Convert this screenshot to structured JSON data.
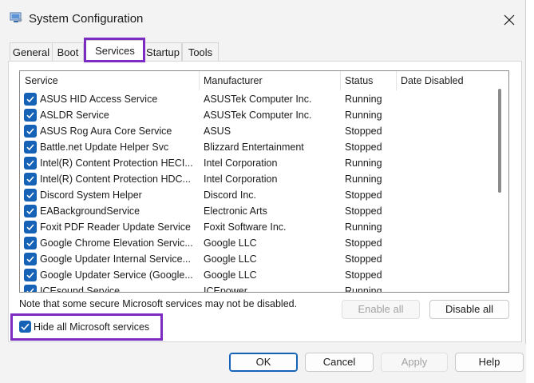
{
  "window": {
    "title": "System Configuration"
  },
  "tabs": [
    {
      "label": "General"
    },
    {
      "label": "Boot"
    },
    {
      "label": "Services"
    },
    {
      "label": "Startup"
    },
    {
      "label": "Tools"
    }
  ],
  "active_tab": "Services",
  "table": {
    "columns": [
      "Service",
      "Manufacturer",
      "Status",
      "Date Disabled"
    ],
    "rows": [
      {
        "service": "ASUS HID Access Service",
        "manufacturer": "ASUSTek Computer Inc.",
        "status": "Running",
        "checked": true
      },
      {
        "service": "ASLDR Service",
        "manufacturer": "ASUSTek Computer Inc.",
        "status": "Running",
        "checked": true
      },
      {
        "service": "ASUS Rog Aura Core Service",
        "manufacturer": "ASUS",
        "status": "Stopped",
        "checked": true
      },
      {
        "service": "Battle.net Update Helper Svc",
        "manufacturer": "Blizzard Entertainment",
        "status": "Stopped",
        "checked": true
      },
      {
        "service": "Intel(R) Content Protection HECI...",
        "manufacturer": "Intel Corporation",
        "status": "Running",
        "checked": true
      },
      {
        "service": "Intel(R) Content Protection HDC...",
        "manufacturer": "Intel Corporation",
        "status": "Running",
        "checked": true
      },
      {
        "service": "Discord System Helper",
        "manufacturer": "Discord Inc.",
        "status": "Stopped",
        "checked": true
      },
      {
        "service": "EABackgroundService",
        "manufacturer": "Electronic Arts",
        "status": "Stopped",
        "checked": true
      },
      {
        "service": "Foxit PDF Reader Update Service",
        "manufacturer": "Foxit Software Inc.",
        "status": "Running",
        "checked": true
      },
      {
        "service": "Google Chrome Elevation Servic...",
        "manufacturer": "Google LLC",
        "status": "Stopped",
        "checked": true
      },
      {
        "service": "Google Updater Internal Service...",
        "manufacturer": "Google LLC",
        "status": "Stopped",
        "checked": true
      },
      {
        "service": "Google Updater Service (Google...",
        "manufacturer": "Google LLC",
        "status": "Stopped",
        "checked": true
      },
      {
        "service": "ICEsound Service",
        "manufacturer": "ICEpower",
        "status": "Running",
        "checked": true
      }
    ]
  },
  "note": "Note that some secure Microsoft services may not be disabled.",
  "buttons": {
    "enable_all": "Enable all",
    "disable_all": "Disable all",
    "ok": "OK",
    "cancel": "Cancel",
    "apply": "Apply",
    "help": "Help"
  },
  "hide_ms": {
    "label": "Hide all Microsoft services",
    "checked": true
  },
  "colors": {
    "accent": "#1562b6",
    "highlight": "#7c2cc2"
  }
}
